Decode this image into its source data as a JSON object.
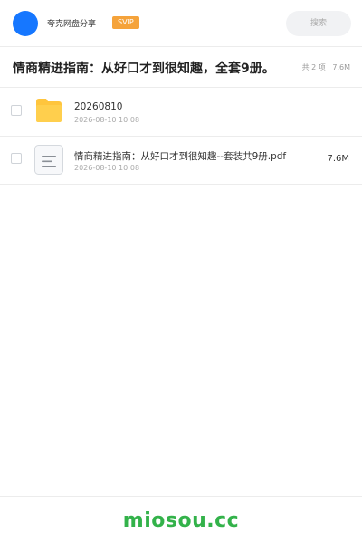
{
  "header": {
    "brand": "夸克网盘分享",
    "vip_badge": "SVIP",
    "search_placeholder": "搜索"
  },
  "share": {
    "title": "情商精进指南：从好口才到很知趣，全套9册。",
    "meta": "共 2 项 · 7.6M"
  },
  "files": [
    {
      "type": "folder",
      "name": "20260810",
      "date": "2026-08-10 10:08",
      "size": ""
    },
    {
      "type": "file",
      "name": "情商精进指南：从好口才到很知趣--套装共9册.pdf",
      "date": "2026-08-10 10:08",
      "size": "7.6M"
    }
  ],
  "footer": {
    "watermark": "miosou.cc"
  },
  "colors": {
    "avatar": "#1677ff",
    "vip": "#f5a33b",
    "folder": "#ffc53d",
    "watermark": "#33b24a"
  }
}
